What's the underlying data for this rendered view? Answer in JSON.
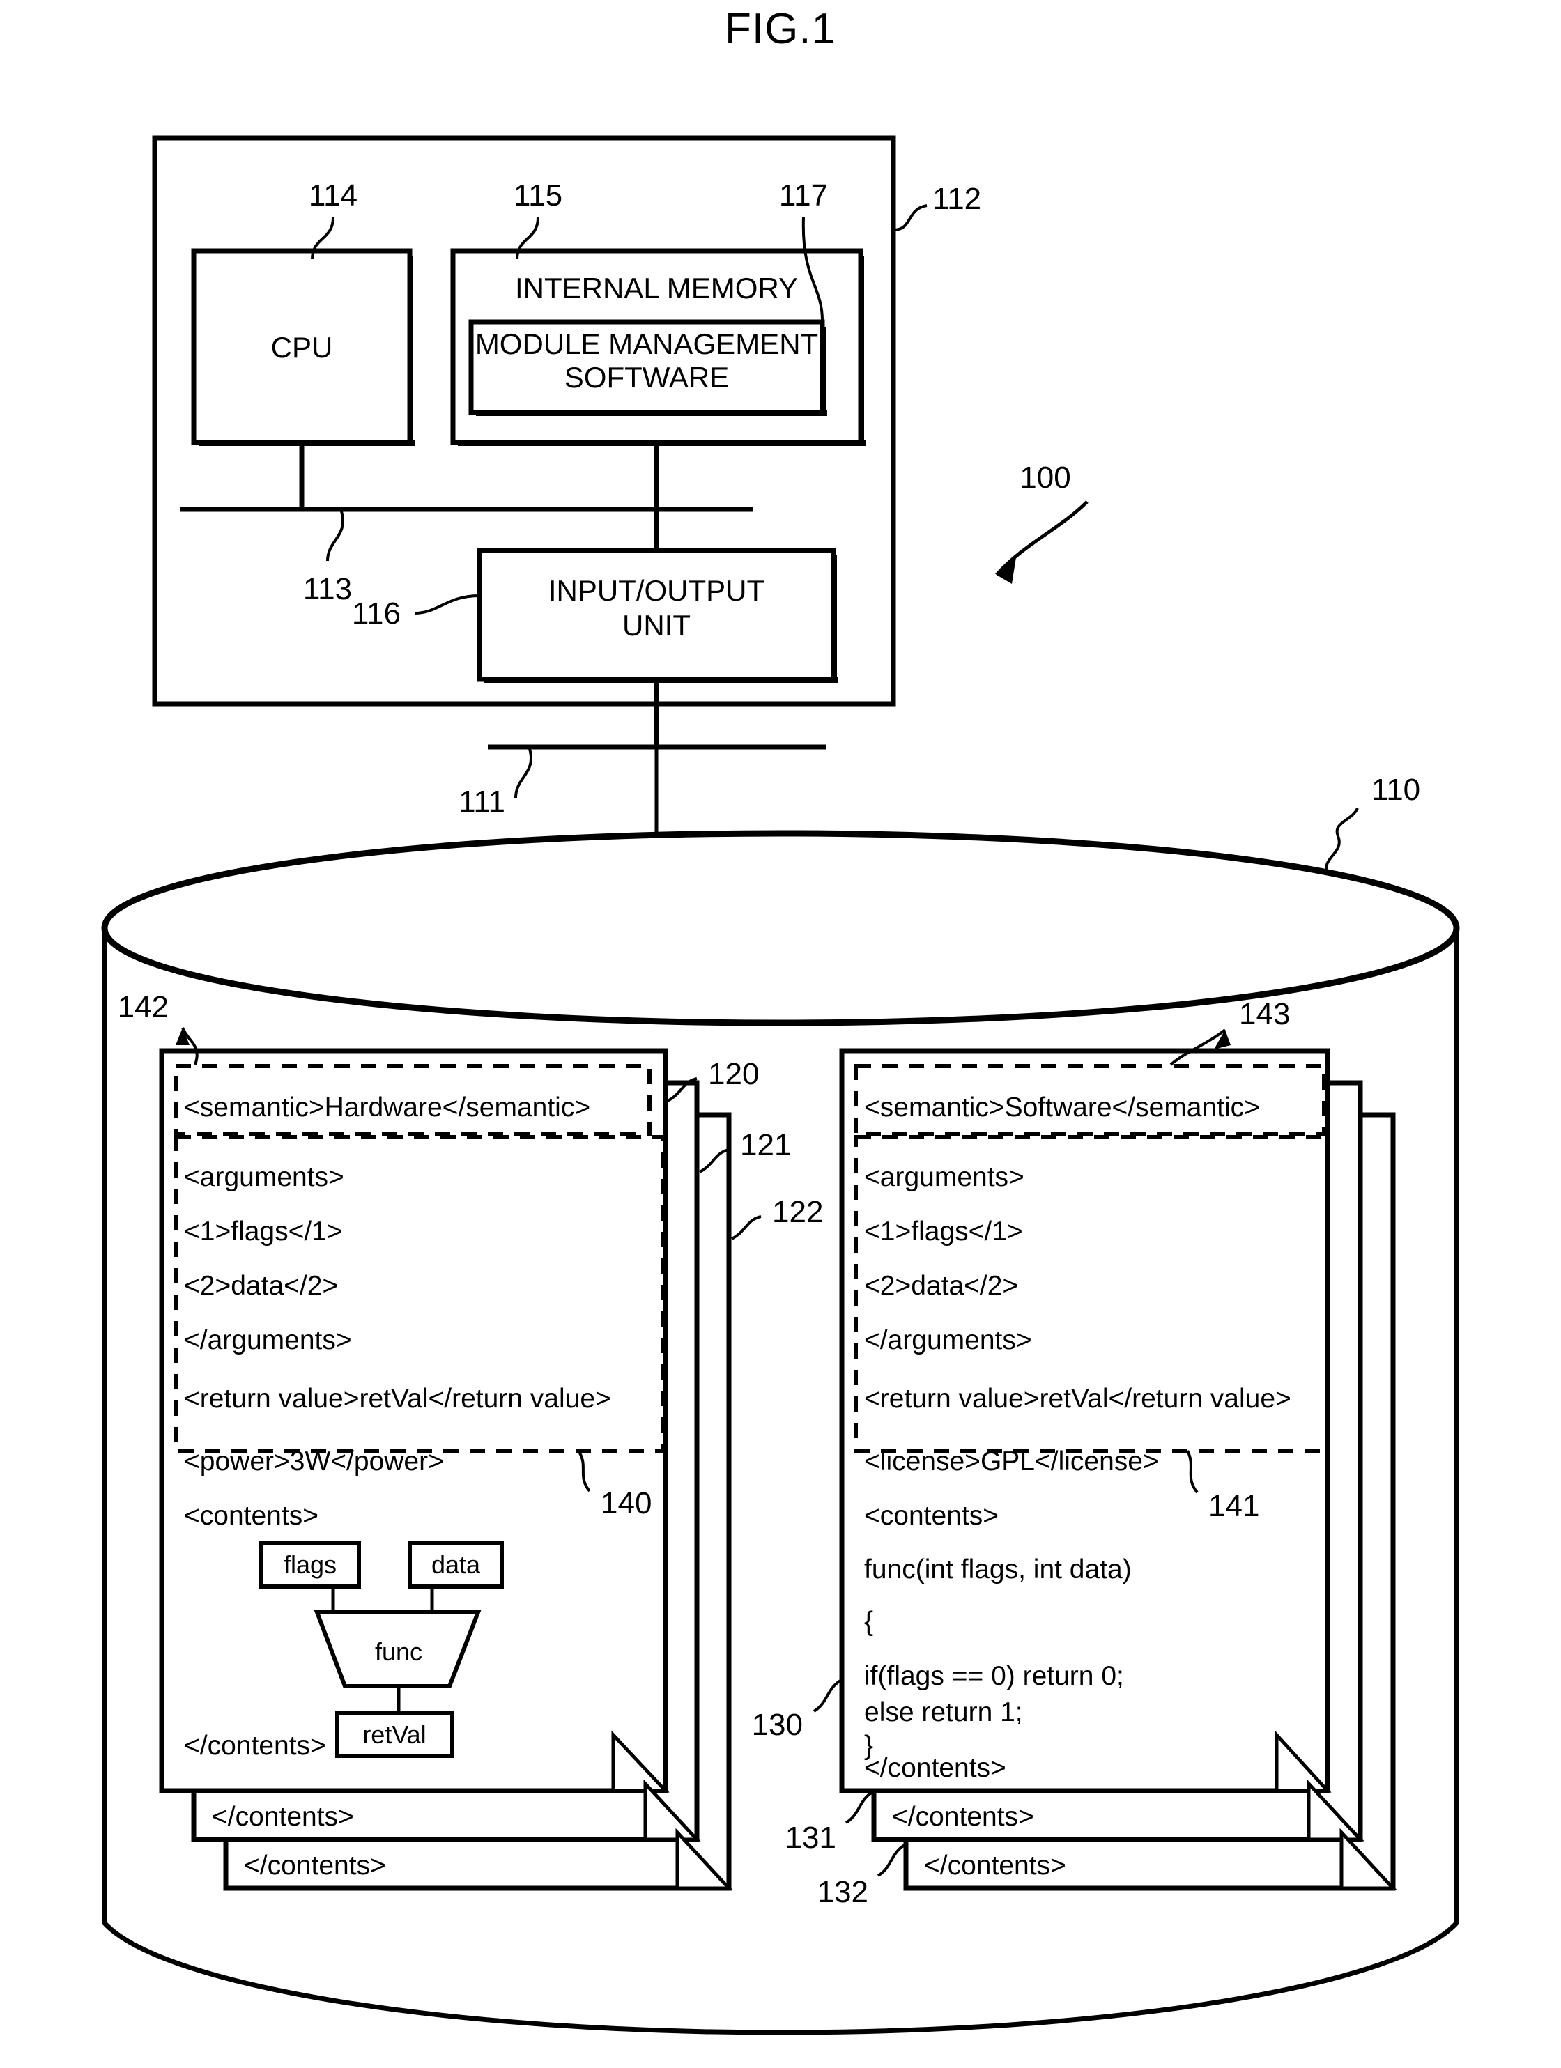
{
  "figure": {
    "title": "FIG.1",
    "system_ref": "100"
  },
  "computer": {
    "outer_ref": "112",
    "bus_ref": "113",
    "network_ref": "111",
    "cpu": {
      "label": "CPU",
      "ref": "114"
    },
    "internal_memory": {
      "label": "INTERNAL MEMORY",
      "ref": "115"
    },
    "module_management_software": {
      "label_line1": "MODULE MANAGEMENT",
      "label_line2": "SOFTWARE",
      "ref": "117"
    },
    "io_unit": {
      "label_line1": "INPUT/OUTPUT",
      "label_line2": "UNIT",
      "ref": "116"
    }
  },
  "storage": {
    "ref": "110"
  },
  "hardware_card": {
    "stack_refs": [
      "120",
      "121",
      "122"
    ],
    "semantic_box_ref": "142",
    "arguments_box_ref": "140",
    "lines": [
      "<semantic>Hardware</semantic>",
      "<arguments>",
      " <1>flags</1>",
      " <2>data</2>",
      "</arguments>",
      "<return value>retVal</return value>",
      "<power>3W</power>",
      "<contents>",
      "</contents>"
    ],
    "circuit": {
      "input_1": "flags",
      "input_2": "data",
      "function": "func",
      "output": "retVal"
    },
    "stack_line_2": "</contents>",
    "stack_line_3": "</contents>"
  },
  "software_card": {
    "stack_refs": [
      "130",
      "131",
      "132"
    ],
    "semantic_box_ref": "143",
    "arguments_box_ref": "141",
    "lines": [
      "<semantic>Software</semantic>",
      "<arguments>",
      " <1>flags</1>",
      " <2>data</2>",
      "</arguments>",
      "<return value>retVal</return value>",
      "<license>GPL</license>",
      "<contents>",
      "func(int flags, int data)",
      "{",
      "  if(flags == 0) return 0;",
      "  else return 1;",
      "}",
      "</contents>"
    ],
    "stack_line_2": "</contents>",
    "stack_line_3": "</contents>"
  },
  "colors": {
    "ink": "#000000",
    "paper": "#ffffff"
  }
}
